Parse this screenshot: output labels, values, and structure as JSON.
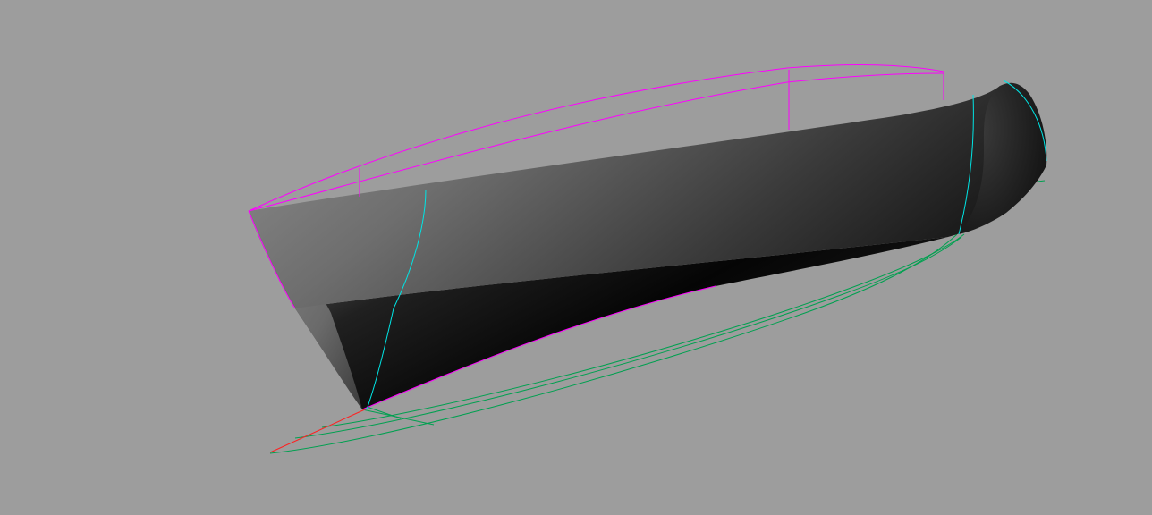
{
  "viewport": {
    "background": "#9d9d9d"
  },
  "colors": {
    "sheer_line": "#ff00ff",
    "station_line": "#00e5e5",
    "waterline": "#00a050",
    "axis": "#ff2020",
    "hull_light": "#8a8a8a",
    "hull_dark": "#000000"
  },
  "layers": [
    "hull-surface",
    "sheer-curves",
    "station-curves",
    "waterline-curves",
    "axis-line"
  ]
}
